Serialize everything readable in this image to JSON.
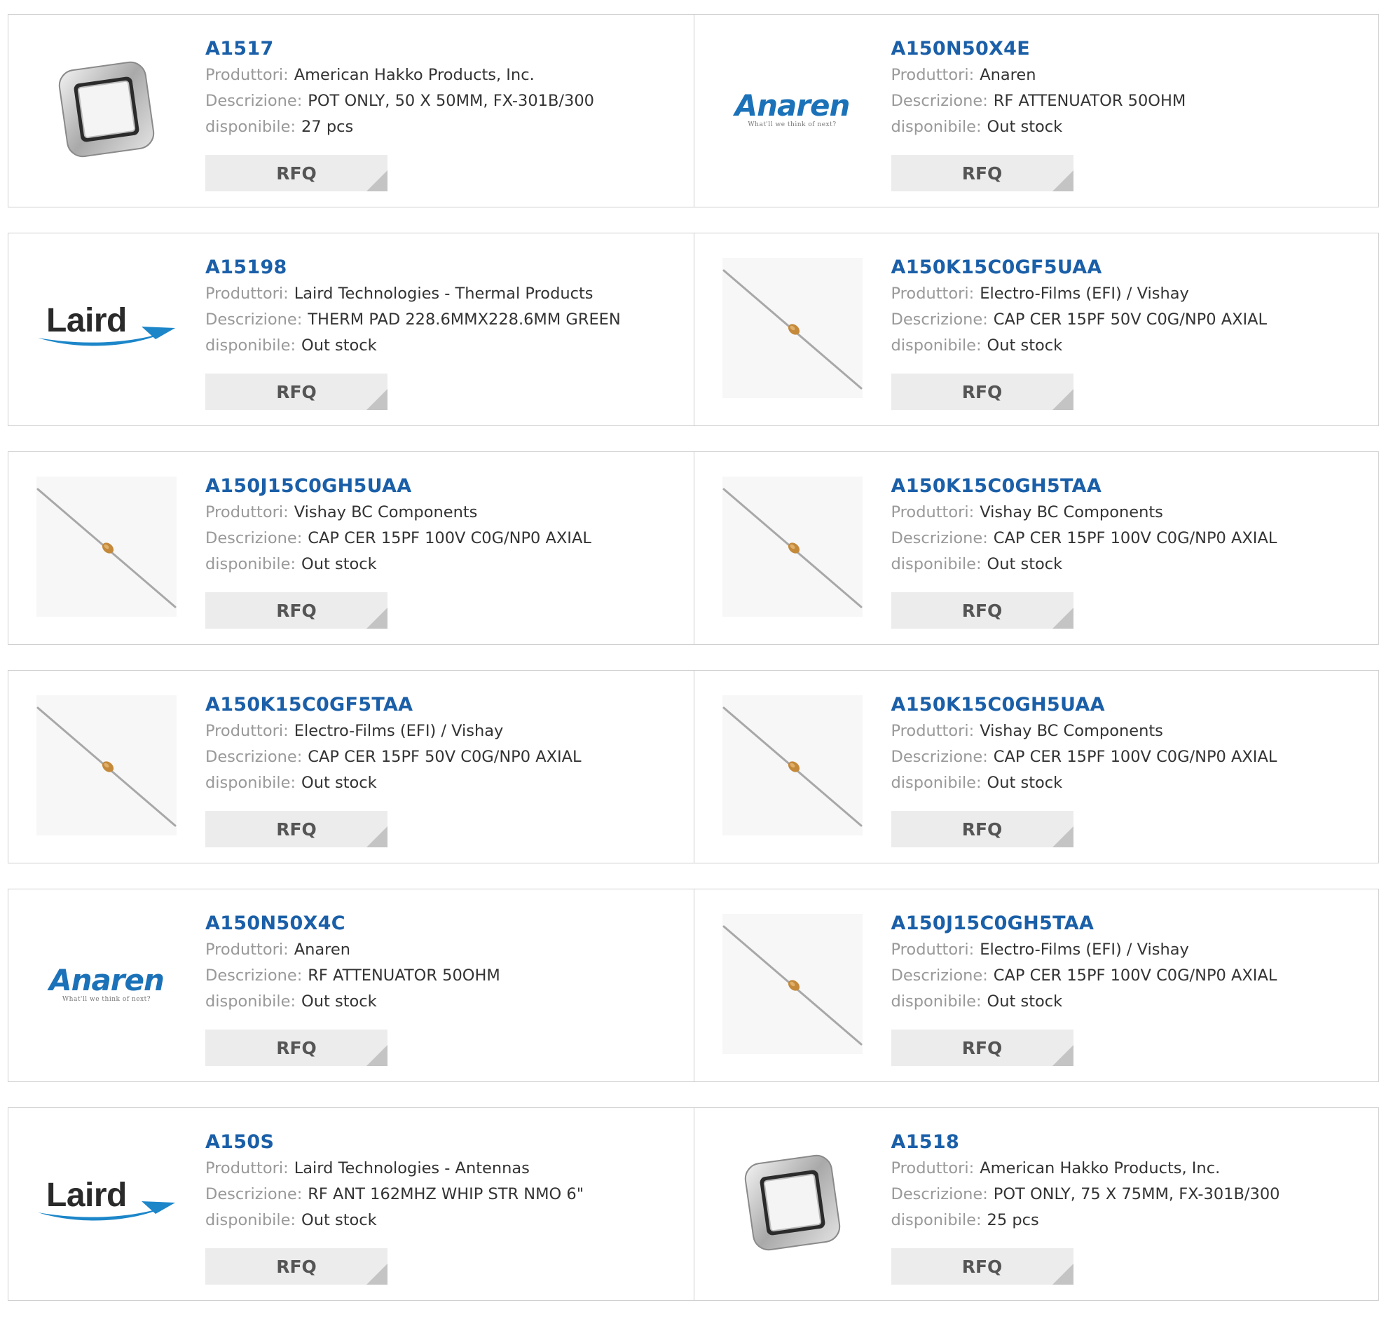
{
  "labels": {
    "manufacturer": "Produttori:",
    "description": "Descrizione:",
    "availability": "disponibile:",
    "rfq": "RFQ"
  },
  "products": [
    {
      "part": "A1517",
      "manufacturer": "American Hakko Products, Inc.",
      "description": "POT ONLY, 50 X 50MM, FX-301B/300",
      "availability": "27 pcs",
      "image": "hakko-pot-icon"
    },
    {
      "part": "A150N50X4E",
      "manufacturer": "Anaren",
      "description": "RF ATTENUATOR 50OHM",
      "availability": "Out stock",
      "image": "anaren-logo"
    },
    {
      "part": "A15198",
      "manufacturer": "Laird Technologies - Thermal Products",
      "description": "THERM PAD 228.6MMX228.6MM GREEN",
      "availability": "Out stock",
      "image": "laird-logo"
    },
    {
      "part": "A150K15C0GF5UAA",
      "manufacturer": "Electro-Films (EFI) / Vishay",
      "description": "CAP CER 15PF 50V C0G/NP0 AXIAL",
      "availability": "Out stock",
      "image": "axial-capacitor-icon"
    },
    {
      "part": "A150J15C0GH5UAA",
      "manufacturer": "Vishay BC Components",
      "description": "CAP CER 15PF 100V C0G/NP0 AXIAL",
      "availability": "Out stock",
      "image": "axial-capacitor-icon"
    },
    {
      "part": "A150K15C0GH5TAA",
      "manufacturer": "Vishay BC Components",
      "description": "CAP CER 15PF 100V C0G/NP0 AXIAL",
      "availability": "Out stock",
      "image": "axial-capacitor-icon"
    },
    {
      "part": "A150K15C0GF5TAA",
      "manufacturer": "Electro-Films (EFI) / Vishay",
      "description": "CAP CER 15PF 50V C0G/NP0 AXIAL",
      "availability": "Out stock",
      "image": "axial-capacitor-icon"
    },
    {
      "part": "A150K15C0GH5UAA",
      "manufacturer": "Vishay BC Components",
      "description": "CAP CER 15PF 100V C0G/NP0 AXIAL",
      "availability": "Out stock",
      "image": "axial-capacitor-icon"
    },
    {
      "part": "A150N50X4C",
      "manufacturer": "Anaren",
      "description": "RF ATTENUATOR 50OHM",
      "availability": "Out stock",
      "image": "anaren-logo"
    },
    {
      "part": "A150J15C0GH5TAA",
      "manufacturer": "Electro-Films (EFI) / Vishay",
      "description": "CAP CER 15PF 100V C0G/NP0 AXIAL",
      "availability": "Out stock",
      "image": "axial-capacitor-icon"
    },
    {
      "part": "A150S",
      "manufacturer": "Laird Technologies - Antennas",
      "description": "RF ANT 162MHZ WHIP STR NMO 6\"",
      "availability": "Out stock",
      "image": "laird-logo"
    },
    {
      "part": "A1518",
      "manufacturer": "American Hakko Products, Inc.",
      "description": "POT ONLY, 75 X 75MM, FX-301B/300",
      "availability": "25 pcs",
      "image": "hakko-pot-icon"
    }
  ],
  "logos": {
    "anaren_word": "Anaren",
    "anaren_tagline": "What'll we think of next?",
    "laird_word": "Laird"
  },
  "colors": {
    "part_link": "#1a5fa8",
    "label": "#999999",
    "value": "#333333",
    "rfq_bg": "#ececec",
    "border": "#cfcfcf"
  }
}
